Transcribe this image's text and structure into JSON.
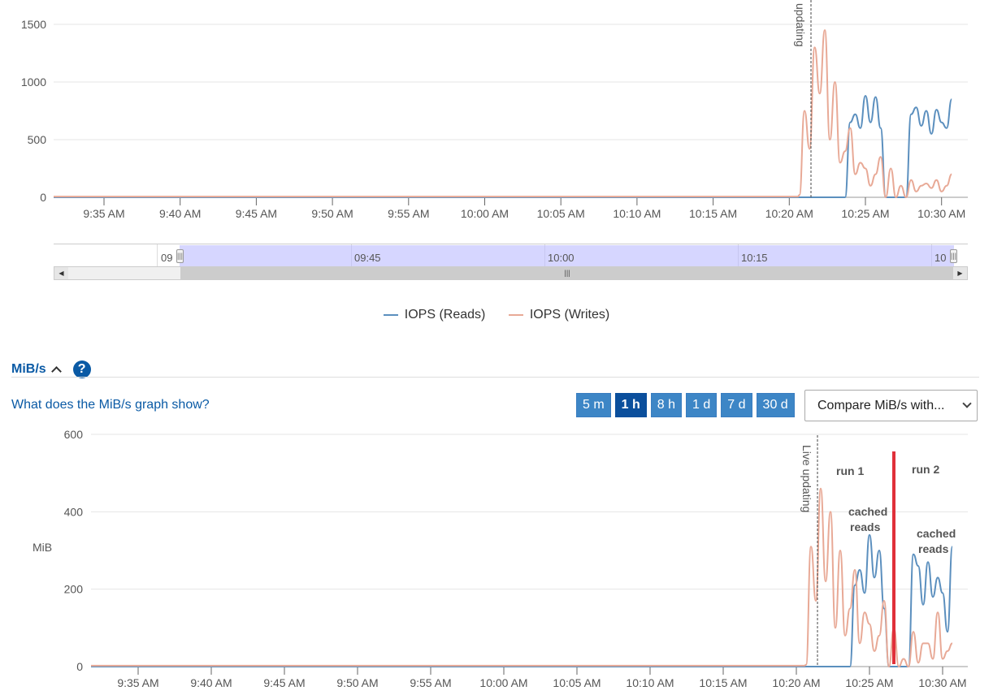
{
  "iops_chart": {
    "y_ticks": [
      "1500",
      "1000",
      "500",
      "0"
    ],
    "x_ticks": [
      "9:35 AM",
      "9:40 AM",
      "9:45 AM",
      "9:50 AM",
      "9:55 AM",
      "10:00 AM",
      "10:05 AM",
      "10:10 AM",
      "10:15 AM",
      "10:20 AM",
      "10:25 AM",
      "10:30 AM"
    ],
    "live_label": "updating"
  },
  "navigator": {
    "labels": [
      "09:45",
      "10:00",
      "10:15"
    ],
    "left_edge_label": "09",
    "right_edge_label": "10",
    "handle_glyph": "|||",
    "scroll_left": "◀",
    "scroll_right": "▶"
  },
  "legend": {
    "reads": "IOPS (Reads)",
    "writes": "IOPS (Writes)"
  },
  "mib_section": {
    "title": "MiB/s",
    "help_glyph": "?",
    "help_link": "What does the MiB/s graph show?",
    "range_buttons": [
      "5 m",
      "1 h",
      "8 h",
      "1 d",
      "7 d",
      "30 d"
    ],
    "active_range": "1 h",
    "compare_value": "Compare MiB/s with..."
  },
  "mib_chart": {
    "y_ticks": [
      "600",
      "400",
      "200",
      "0"
    ],
    "y_label": "MiB",
    "x_ticks": [
      "9:35 AM",
      "9:40 AM",
      "9:45 AM",
      "9:50 AM",
      "9:55 AM",
      "10:00 AM",
      "10:05 AM",
      "10:10 AM",
      "10:15 AM",
      "10:20 AM",
      "10:25 AM",
      "10:30 AM"
    ],
    "live_label": "Live updating",
    "annotations": {
      "run1": "run 1",
      "run2": "run 2",
      "cached1_line1": "cached",
      "cached1_line2": "reads",
      "cached2_line1": "cached",
      "cached2_line2": "reads"
    }
  },
  "colors": {
    "reads": "#5b8fbe",
    "writes": "#e8a996",
    "annotation_red": "#e0303a",
    "annotation_blue": "#3a7fd0"
  },
  "chart_data": [
    {
      "type": "line",
      "x": [
        "10:20:40",
        "10:21:00",
        "10:21:20",
        "10:21:40",
        "10:22:00",
        "10:22:20",
        "10:22:40",
        "10:23:00",
        "10:23:20",
        "10:23:40",
        "10:24:00",
        "10:24:20",
        "10:24:40",
        "10:25:00",
        "10:25:20",
        "10:25:40",
        "10:26:00",
        "10:26:20",
        "10:26:40",
        "10:27:00",
        "10:27:20",
        "10:27:40",
        "10:28:00",
        "10:28:20",
        "10:28:40",
        "10:29:00",
        "10:29:20",
        "10:29:40",
        "10:30:00",
        "10:30:20",
        "10:30:40"
      ],
      "series": [
        {
          "name": "IOPS (Reads)",
          "values": [
            0,
            0,
            0,
            0,
            0,
            0,
            0,
            0,
            0,
            0,
            650,
            720,
            600,
            880,
            650,
            870,
            600,
            0,
            0,
            0,
            0,
            0,
            720,
            780,
            620,
            750,
            550,
            760,
            650,
            600,
            850
          ]
        },
        {
          "name": "IOPS (Writes)",
          "values": [
            20,
            750,
            420,
            1300,
            900,
            1450,
            500,
            1000,
            300,
            400,
            600,
            200,
            300,
            250,
            100,
            200,
            350,
            0,
            250,
            0,
            100,
            0,
            150,
            50,
            100,
            120,
            80,
            150,
            50,
            100,
            200
          ]
        }
      ],
      "ylim": [
        0,
        1500
      ],
      "baseline_before_10_20": {
        "reads": 0,
        "writes": 5
      }
    },
    {
      "type": "line",
      "x": [
        "10:20:40",
        "10:21:00",
        "10:21:20",
        "10:21:40",
        "10:22:00",
        "10:22:20",
        "10:22:40",
        "10:23:00",
        "10:23:20",
        "10:23:40",
        "10:24:00",
        "10:24:20",
        "10:24:40",
        "10:25:00",
        "10:25:20",
        "10:25:40",
        "10:26:00",
        "10:26:20",
        "10:26:40",
        "10:27:00",
        "10:27:20",
        "10:27:40",
        "10:28:00",
        "10:28:20",
        "10:28:40",
        "10:29:00",
        "10:29:20",
        "10:29:40",
        "10:30:00",
        "10:30:20",
        "10:30:40"
      ],
      "series": [
        {
          "name": "IOPS (Reads)",
          "values": [
            0,
            0,
            0,
            0,
            0,
            0,
            0,
            0,
            0,
            0,
            210,
            250,
            190,
            340,
            230,
            300,
            150,
            0,
            0,
            0,
            0,
            0,
            290,
            260,
            160,
            270,
            180,
            230,
            190,
            90,
            310
          ]
        },
        {
          "name": "IOPS (Writes)",
          "values": [
            5,
            310,
            170,
            460,
            220,
            400,
            100,
            300,
            80,
            150,
            250,
            60,
            140,
            110,
            40,
            80,
            170,
            0,
            100,
            0,
            20,
            0,
            90,
            10,
            60,
            60,
            20,
            140,
            20,
            40,
            60
          ]
        }
      ],
      "ylabel": "MiB",
      "ylim": [
        0,
        600
      ]
    }
  ]
}
